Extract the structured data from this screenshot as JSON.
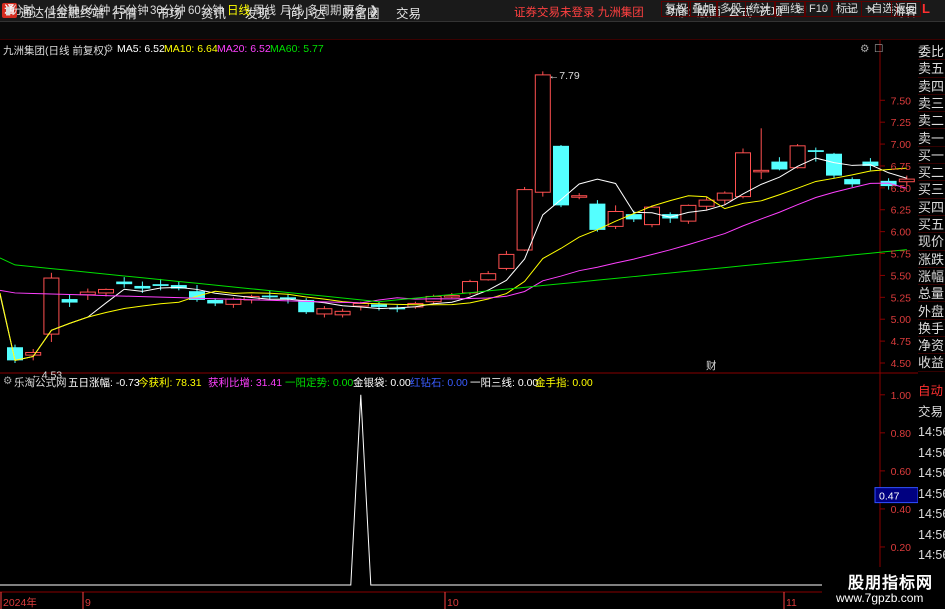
{
  "titlebar": {
    "app_name": "通达信金融终端",
    "menus": [
      "行情",
      "市场",
      "资讯",
      "发现",
      "问小达",
      "财富圈",
      "交易"
    ],
    "notice": "证券交易未登录 九洲集团",
    "right_menus": [
      "功能",
      "版面",
      "公式",
      "选项"
    ],
    "guest": "游客"
  },
  "toolbar": {
    "periods": [
      "分时",
      "1分钟",
      "5分钟",
      "15分钟",
      "30分钟",
      "60分钟",
      "日线",
      "周线",
      "月线",
      "多周期",
      "更多"
    ],
    "active_period": "日线",
    "right_buttons": [
      "复权",
      "叠加",
      "多股",
      "统计",
      "画线",
      "F10",
      "标记",
      "+自选",
      "返回"
    ],
    "mode_letter": "L"
  },
  "main_chart": {
    "stock_title": "九洲集团(日线 前复权)",
    "ma5": "MA5: 6.52",
    "ma10": "MA10: 6.64",
    "ma20": "MA20: 6.52",
    "ma60": "MA60: 5.77",
    "high_label": "7.79",
    "low_label": "4.53",
    "finance_marker": "财",
    "price_ticks": [
      "7.50",
      "7.25",
      "7.00",
      "6.75",
      "6.50",
      "6.25",
      "6.00",
      "5.75",
      "5.50",
      "5.25",
      "5.00",
      "4.75",
      "4.50"
    ],
    "colors": {
      "ma5": "#ffffff",
      "ma10": "#ffff00",
      "ma20": "#ff40ff",
      "ma60": "#00e000",
      "up": "#ff5050",
      "down": "#54ffff"
    }
  },
  "indicator": {
    "name": "乐淘公式网",
    "items": [
      {
        "label": "五日涨幅:",
        "value": "-0.73",
        "color": "#ffffff"
      },
      {
        "label": "今获利:",
        "value": "78.31",
        "color": "#ffff00"
      },
      {
        "label": "获利比增:",
        "value": "31.41",
        "color": "#ff40ff"
      },
      {
        "label": "一阳定势:",
        "value": "0.00",
        "color": "#00e000"
      },
      {
        "label": "金银袋:",
        "value": "0.00",
        "color": "#ffffff"
      },
      {
        "label": "红钻石:",
        "value": "0.00",
        "color": "#3a5cff"
      },
      {
        "label": "一阳三线:",
        "value": "0.00",
        "color": "#ffffff"
      },
      {
        "label": "金手指:",
        "value": "0.00",
        "color": "#ffff00"
      }
    ],
    "ticks": [
      "1.00",
      "0.80",
      "0.60",
      "0.40",
      "0.20"
    ],
    "cursor_value": "0.47"
  },
  "date_axis": {
    "labels": [
      "2024年",
      "9",
      "10",
      "11"
    ]
  },
  "side_panel": {
    "quote_labels": [
      "委比",
      "卖五",
      "卖四",
      "卖三",
      "卖二",
      "卖一",
      "买一",
      "买二",
      "买三",
      "买四",
      "买五",
      "现价",
      "涨跌",
      "涨幅",
      "总量",
      "外盘",
      "换手",
      "净资",
      "收益"
    ],
    "trade_labels": [
      "自动",
      "交易",
      "14:56",
      "14:56",
      "14:56",
      "14:56",
      "14:56",
      "14:56",
      "14:56",
      "14:56",
      "14:56"
    ]
  },
  "watermark": {
    "line1": "股朋指标网",
    "line2": "www.7gpzb.com"
  }
}
